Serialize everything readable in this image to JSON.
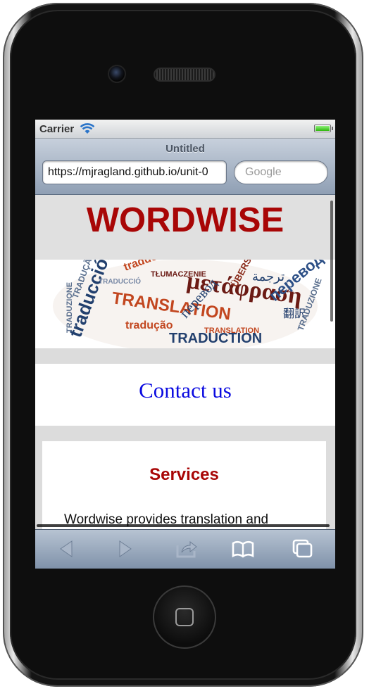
{
  "status_bar": {
    "carrier": "Carrier",
    "battery_level": 1.0,
    "battery_color": "#3cc81a"
  },
  "browser": {
    "page_title": "Untitled",
    "url": "https://mjragland.github.io/unit-0",
    "search_placeholder": "Google"
  },
  "page": {
    "site_title": "WORDWISE",
    "contact_link": "Contact us",
    "services_heading": "Services",
    "services_text": "Wordwise provides translation and",
    "colors": {
      "brand_red": "#a80606",
      "link_blue": "#0a0ae0",
      "band_gray": "#e0e0e0"
    },
    "word_cloud": {
      "words": [
        "TRANSLATION",
        "μετάφραση",
        "traducción",
        "TRADUCTION",
        "перевод",
        "TŁUMACZENIE",
        "tradução",
        "traducció",
        "ÜBERSETZUNG",
        "TRADUZIONE",
        "翻訳",
        "ترجمة"
      ]
    }
  },
  "toolbar": {
    "buttons": [
      "back-icon",
      "forward-icon",
      "share-icon",
      "bookmarks-icon",
      "tabs-icon"
    ]
  }
}
